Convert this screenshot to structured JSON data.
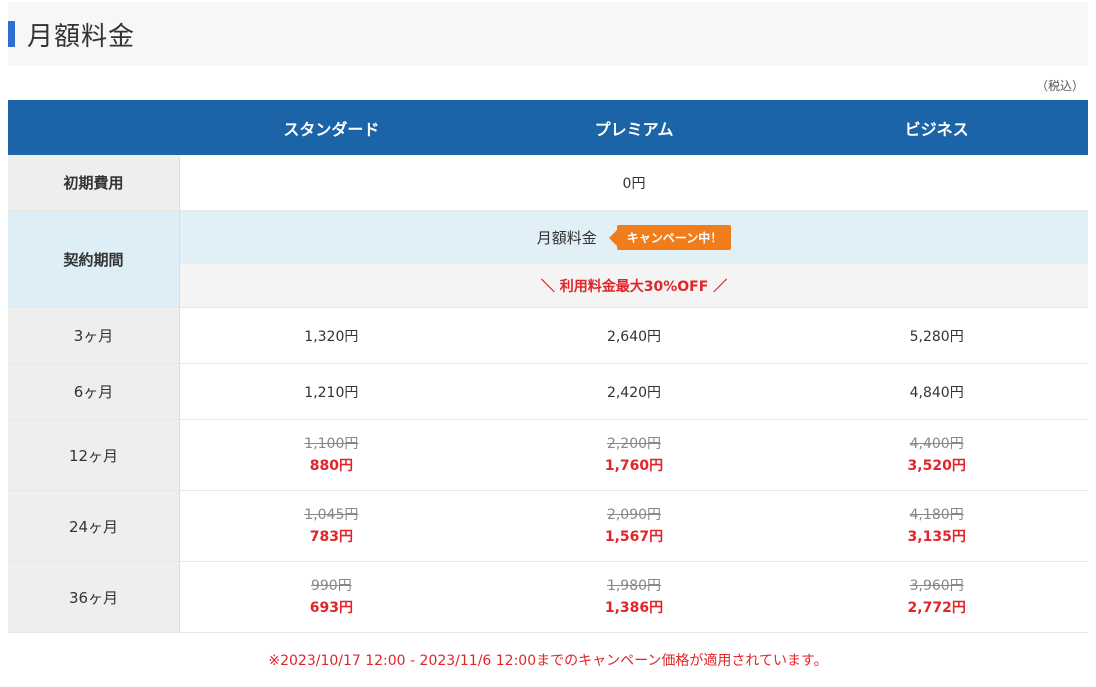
{
  "header": {
    "title": "月額料金",
    "accent_color": "#2f6fd1"
  },
  "tax_note": "（税込）",
  "table": {
    "columns": [
      "スタンダード",
      "プレミアム",
      "ビジネス"
    ],
    "header_color": "#1b64a8",
    "initial_fee": {
      "label": "初期費用",
      "value": "0円"
    },
    "contract": {
      "label": "契約期間",
      "fee_label": "月額料金",
      "badge": "キャンペーン中！",
      "promo": "＼ 利用料金最大30%OFF ／"
    },
    "rows": [
      {
        "label": "3ヶ月",
        "prices": [
          {
            "price": "1,320円"
          },
          {
            "price": "2,640円"
          },
          {
            "price": "5,280円"
          }
        ]
      },
      {
        "label": "6ヶ月",
        "prices": [
          {
            "price": "1,210円"
          },
          {
            "price": "2,420円"
          },
          {
            "price": "4,840円"
          }
        ]
      },
      {
        "label": "12ヶ月",
        "prices": [
          {
            "old": "1,100円",
            "new": "880円"
          },
          {
            "old": "2,200円",
            "new": "1,760円"
          },
          {
            "old": "4,400円",
            "new": "3,520円"
          }
        ]
      },
      {
        "label": "24ヶ月",
        "prices": [
          {
            "old": "1,045円",
            "new": "783円"
          },
          {
            "old": "2,090円",
            "new": "1,567円"
          },
          {
            "old": "4,180円",
            "new": "3,135円"
          }
        ]
      },
      {
        "label": "36ヶ月",
        "prices": [
          {
            "old": "990円",
            "new": "693円"
          },
          {
            "old": "1,980円",
            "new": "1,386円"
          },
          {
            "old": "3,960円",
            "new": "2,772円"
          }
        ]
      }
    ]
  },
  "footnote": "※2023/10/17 12:00 - 2023/11/6 12:00までのキャンペーン価格が適用されています。",
  "colors": {
    "campaign_red": "#e0262b",
    "badge_orange": "#f07d1a",
    "contract_bg": "#ddeef6"
  }
}
